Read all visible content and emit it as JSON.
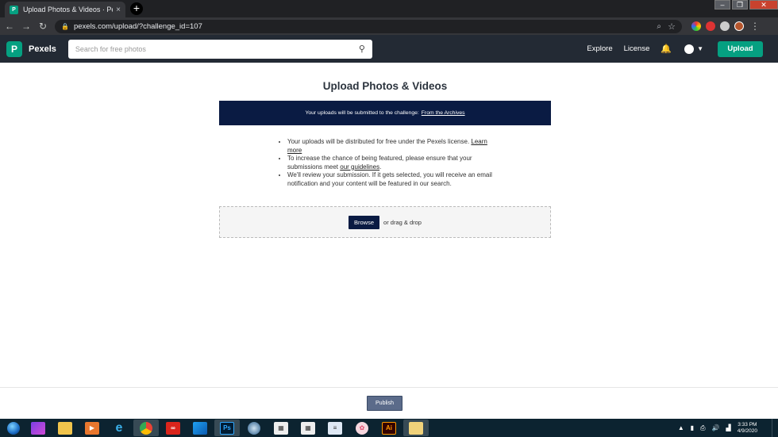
{
  "browser": {
    "tab_title": "Upload Photos & Videos · Pexels",
    "tab_close": "×",
    "new_tab": "+",
    "url": "pexels.com/upload/?challenge_id=107"
  },
  "site": {
    "logo_letter": "P",
    "logo_name": "Pexels",
    "search_placeholder": "Search for free photos",
    "nav_explore": "Explore",
    "nav_license": "License",
    "upload_button": "Upload"
  },
  "main": {
    "title": "Upload Photos & Videos",
    "banner_text": "Your uploads will be submitted to the challenge:",
    "banner_link": "From the Archives",
    "note1_text": "Your uploads will be distributed for free under the Pexels license.",
    "note1_link": "Learn more",
    "note2_text": "To increase the chance of being featured, please ensure that your submissions meet",
    "note2_link": "our guidelines",
    "note2_end": ".",
    "note3_text": "We'll review your submission. If it gets selected, you will receive an email notification and your content will be featured in our search.",
    "browse_button": "Browse",
    "drag_drop_text": "or drag & drop"
  },
  "footer": {
    "publish_button": "Publish"
  },
  "taskbar": {
    "time": "3:33 PM",
    "date": "4/9/2020",
    "ps_label": "Ps",
    "ai_label": "Ai"
  },
  "colors": {
    "brand_green": "#05a081",
    "navy_banner": "#0a1b43",
    "header_bg": "#232a34"
  }
}
